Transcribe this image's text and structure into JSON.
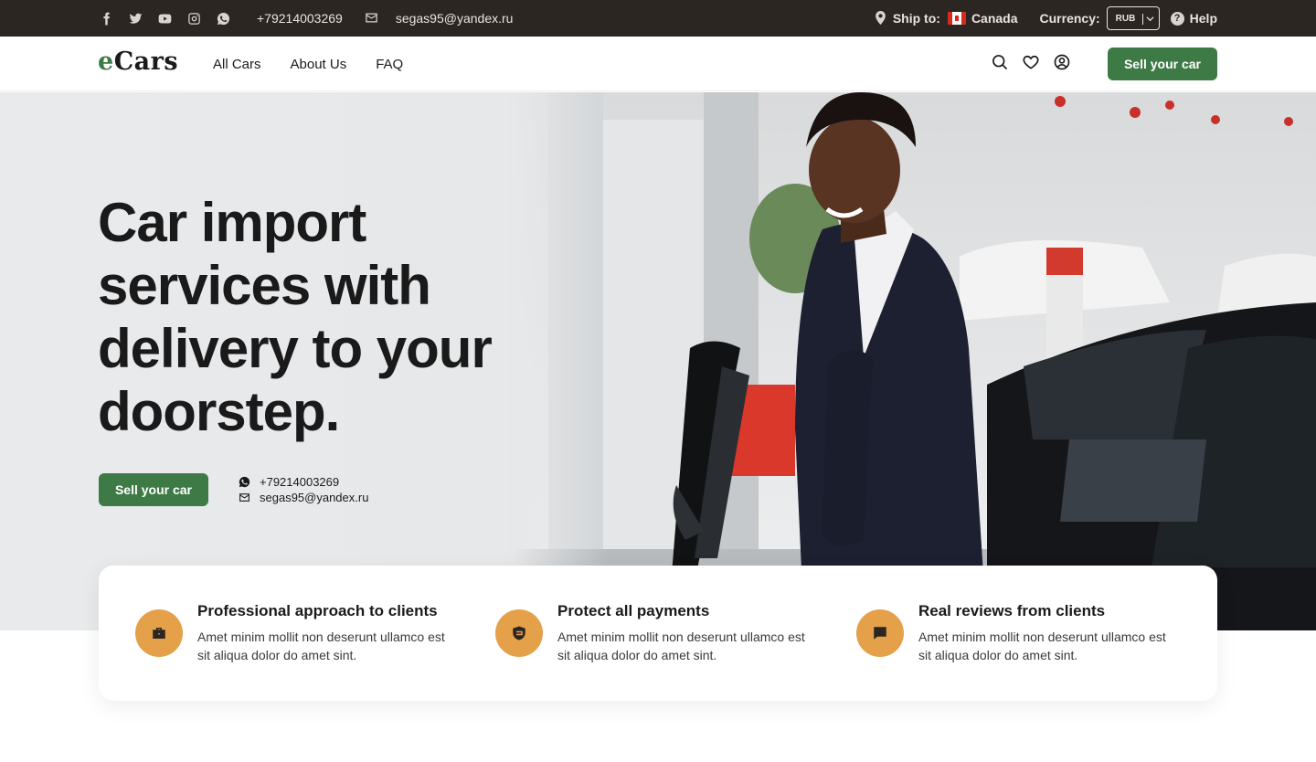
{
  "topbar": {
    "social_icons": [
      "facebook-icon",
      "twitter-icon",
      "youtube-icon",
      "instagram-icon",
      "whatsapp-icon"
    ],
    "phone": "+79214003269",
    "email": "segas95@yandex.ru",
    "ship_label": "Ship to:",
    "ship_country": "Canada",
    "currency_label": "Currency:",
    "currency_value": "RUB",
    "help_label": "Help"
  },
  "header": {
    "logo_e": "e",
    "logo_rest": "Cars",
    "nav": [
      "All Cars",
      "About Us",
      "FAQ"
    ],
    "icons": [
      "search-icon",
      "heart-icon",
      "user-icon"
    ],
    "cta": "Sell your car"
  },
  "hero": {
    "title": "Car import services with delivery to your doorstep.",
    "cta": "Sell your car",
    "phone": "+79214003269",
    "email": "segas95@yandex.ru"
  },
  "features": [
    {
      "icon": "briefcase-icon",
      "title": "Professional approach to clients",
      "text": "Amet minim mollit non deserunt ullamco est sit aliqua dolor do amet sint."
    },
    {
      "icon": "payment-shield-icon",
      "title": "Protect all payments",
      "text": "Amet minim mollit non deserunt ullamco est sit aliqua dolor do amet sint."
    },
    {
      "icon": "review-icon",
      "title": "Real reviews from clients",
      "text": "Amet minim mollit non deserunt ullamco est sit aliqua dolor do amet sint."
    }
  ],
  "colors": {
    "brand_green": "#3e7a45",
    "topbar_bg": "#2b2622",
    "accent_orange": "#e5a04a"
  }
}
